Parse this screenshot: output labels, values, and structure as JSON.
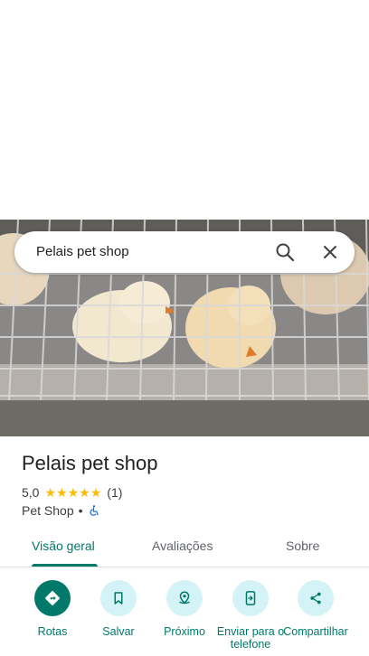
{
  "search": {
    "query": "Pelais pet shop"
  },
  "place": {
    "title": "Pelais pet shop",
    "rating_value": "5,0",
    "stars": [
      "★",
      "★",
      "★",
      "★",
      "★"
    ],
    "rating_count": "(1)",
    "category": "Pet Shop",
    "separator": "•"
  },
  "tabs": [
    {
      "label": "Visão geral",
      "active": true
    },
    {
      "label": "Avaliações",
      "active": false
    },
    {
      "label": "Sobre",
      "active": false
    }
  ],
  "actions": [
    {
      "label": "Rotas",
      "icon": "directions-icon"
    },
    {
      "label": "Salvar",
      "icon": "bookmark-icon"
    },
    {
      "label": "Próximo",
      "icon": "nearby-icon"
    },
    {
      "label": "Enviar para o telefone",
      "icon": "send-to-phone-icon"
    },
    {
      "label": "Compartilhar",
      "icon": "share-icon"
    }
  ],
  "colors": {
    "accent": "#00796b",
    "action_bg": "#d4f3f6",
    "star": "#fbbc04"
  }
}
